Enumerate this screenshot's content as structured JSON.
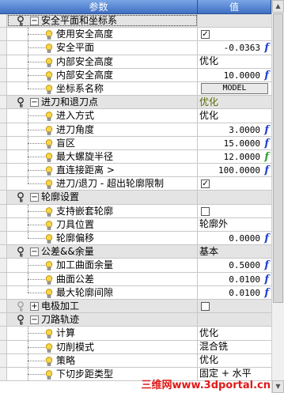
{
  "header": {
    "name_col": "参数",
    "value_col": "值"
  },
  "rows": [
    {
      "type": "group",
      "label": "安全平面和坐标系",
      "toggle": "−",
      "selected": true
    },
    {
      "type": "item",
      "label": "使用安全高度",
      "value_kind": "checkbox",
      "checked": true
    },
    {
      "type": "item",
      "label": "安全平面",
      "value": "-0.0363",
      "fx": "blue"
    },
    {
      "type": "item",
      "label": "内部安全高度",
      "value": "优化"
    },
    {
      "type": "item",
      "label": "内部安全高度",
      "value": "10.0000",
      "fx": "blue"
    },
    {
      "type": "item",
      "label": "坐标系名称",
      "value_kind": "button",
      "value": "MODEL",
      "last": true
    },
    {
      "type": "group",
      "label": "进刀和退刀点",
      "toggle": "−",
      "value": "优化",
      "value_color": "green"
    },
    {
      "type": "item",
      "label": "进入方式",
      "value": "优化"
    },
    {
      "type": "item",
      "label": "进刀角度",
      "value": "3.0000",
      "fx": "blue"
    },
    {
      "type": "item",
      "label": "盲区",
      "value": "15.0000",
      "fx": "blue"
    },
    {
      "type": "item",
      "label": "最大螺旋半径",
      "value": "12.0000",
      "fx": "green"
    },
    {
      "type": "item",
      "label": "直连接距离 >",
      "value": "100.0000",
      "fx": "blue"
    },
    {
      "type": "item",
      "label": "进刀/退刀 - 超出轮廓限制",
      "value_kind": "checkbox",
      "checked": true,
      "last": true
    },
    {
      "type": "group",
      "label": "轮廓设置",
      "toggle": "−"
    },
    {
      "type": "item",
      "label": "支持嵌套轮廓",
      "value_kind": "checkbox",
      "checked": false
    },
    {
      "type": "item",
      "label": "刀具位置",
      "value": "轮廓外"
    },
    {
      "type": "item",
      "label": "轮廓偏移",
      "value": "0.0000",
      "fx": "blue",
      "last": true
    },
    {
      "type": "group",
      "label": "公差&&余量",
      "toggle": "−",
      "value": "基本"
    },
    {
      "type": "item",
      "label": "加工曲面余量",
      "value": "0.5000",
      "fx": "blue"
    },
    {
      "type": "item",
      "label": "曲面公差",
      "value": "0.0100",
      "fx": "blue"
    },
    {
      "type": "item",
      "label": "最大轮廓间隙",
      "value": "0.0100",
      "fx": "blue",
      "last": true
    },
    {
      "type": "group",
      "label": "电极加工",
      "toggle": "+",
      "value_kind": "checkbox",
      "checked": false,
      "dim_key": true
    },
    {
      "type": "group",
      "label": "刀路轨迹",
      "toggle": "−"
    },
    {
      "type": "item",
      "label": "计算",
      "value": "优化"
    },
    {
      "type": "item",
      "label": "切削模式",
      "value": "混合铣"
    },
    {
      "type": "item",
      "label": "策略",
      "value": "优化"
    },
    {
      "type": "item",
      "label": "下切步距类型",
      "value": "固定 + 水平"
    }
  ],
  "checkmark": "✓",
  "scrollbar": {
    "up": "▲",
    "down": "▼"
  },
  "watermark": "三维网www.3dportal.cn",
  "colors": {
    "header": "#3f6fc2",
    "group_bg": "#e4e4e4",
    "fx_blue": "#1f3fd0",
    "fx_green": "#2ea02e",
    "value_green": "#556b00"
  }
}
